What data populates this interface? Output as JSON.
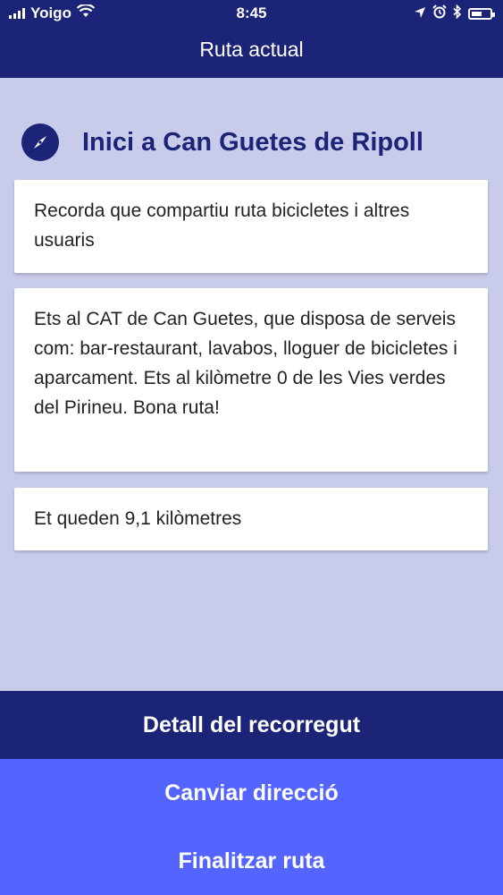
{
  "status_bar": {
    "carrier": "Yoigo",
    "time": "8:45"
  },
  "header": {
    "title": "Ruta actual"
  },
  "route": {
    "title": "Inici a Can Guetes de Ripoll",
    "icon": "compass-icon"
  },
  "cards": [
    "Recorda que compartiu ruta bicicletes i altres usuaris",
    "Ets al CAT de Can Guetes, que disposa de serveis com: bar-restaurant, lavabos, lloguer de bicicletes i aparcament. Ets al kilòmetre 0 de les Vies verdes del Pirineu. Bona ruta!",
    "Et queden 9,1 kilòmetres"
  ],
  "buttons": {
    "detail": "Detall del recorregut",
    "change_direction": "Canviar direcció",
    "finish": "Finalitzar ruta"
  },
  "colors": {
    "primary": "#1c2478",
    "accent": "#5465ff",
    "background": "#c8cbea"
  }
}
